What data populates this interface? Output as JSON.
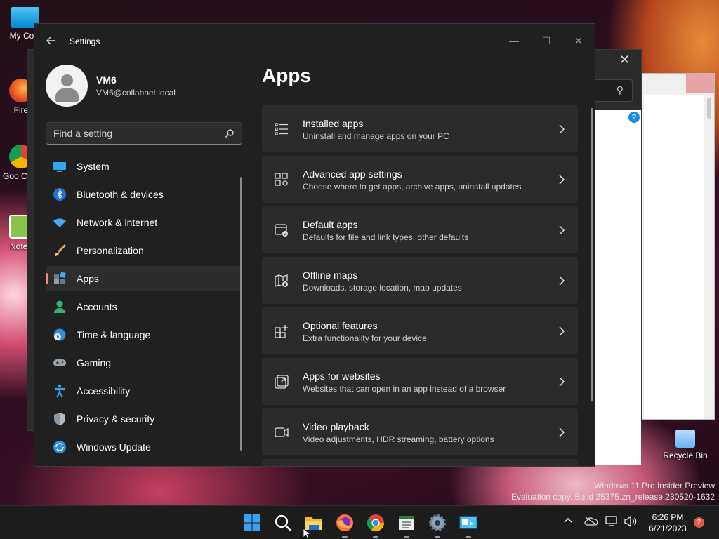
{
  "desktop": {
    "icons": [
      {
        "label": "My Com",
        "icon": "computer-icon"
      },
      {
        "label": "Fire",
        "icon": "firefox-icon"
      },
      {
        "label": "Goo Chro",
        "icon": "chrome-icon"
      },
      {
        "label": "Notep",
        "icon": "notepad-icon"
      }
    ],
    "recycle_bin": "Recycle Bin",
    "watermark": {
      "line1": "Windows 11 Pro Insider Preview",
      "line2": "Evaluation copy. Build 25375.zn_release.230520-1632"
    }
  },
  "settings": {
    "window_title": "Settings",
    "controls": {
      "minimize": "—",
      "maximize": "☐",
      "close": "✕"
    },
    "user": {
      "name": "VM6",
      "email": "VM6@collabnet.local"
    },
    "search": {
      "placeholder": "Find a setting"
    },
    "nav": [
      {
        "label": "System",
        "icon": "system-icon"
      },
      {
        "label": "Bluetooth & devices",
        "icon": "bluetooth-icon"
      },
      {
        "label": "Network & internet",
        "icon": "wifi-icon"
      },
      {
        "label": "Personalization",
        "icon": "brush-icon"
      },
      {
        "label": "Apps",
        "icon": "apps-icon",
        "selected": true
      },
      {
        "label": "Accounts",
        "icon": "person-icon"
      },
      {
        "label": "Time & language",
        "icon": "globe-clock-icon"
      },
      {
        "label": "Gaming",
        "icon": "gamepad-icon"
      },
      {
        "label": "Accessibility",
        "icon": "accessibility-icon"
      },
      {
        "label": "Privacy & security",
        "icon": "shield-icon"
      },
      {
        "label": "Windows Update",
        "icon": "update-icon"
      }
    ],
    "page_title": "Apps",
    "cards": [
      {
        "title": "Installed apps",
        "subtitle": "Uninstall and manage apps on your PC",
        "icon": "list-icon"
      },
      {
        "title": "Advanced app settings",
        "subtitle": "Choose where to get apps, archive apps, uninstall updates",
        "icon": "app-gear-icon"
      },
      {
        "title": "Default apps",
        "subtitle": "Defaults for file and link types, other defaults",
        "icon": "default-apps-icon"
      },
      {
        "title": "Offline maps",
        "subtitle": "Downloads, storage location, map updates",
        "icon": "map-icon"
      },
      {
        "title": "Optional features",
        "subtitle": "Extra functionality for your device",
        "icon": "add-grid-icon"
      },
      {
        "title": "Apps for websites",
        "subtitle": "Websites that can open in an app instead of a browser",
        "icon": "open-link-icon"
      },
      {
        "title": "Video playback",
        "subtitle": "Video adjustments, HDR streaming, battery options",
        "icon": "video-icon"
      }
    ]
  },
  "taskbar": {
    "apps": [
      "start-icon",
      "search-icon",
      "file-explorer-icon",
      "firefox-icon",
      "chrome-icon",
      "notepad-icon",
      "settings-gear-icon",
      "control-panel-icon"
    ],
    "clock_time": "6:26 PM",
    "clock_date": "6/21/2023",
    "notification_count": "2"
  },
  "colors": {
    "accent": "#f08a7a",
    "window_bg": "#202020",
    "card_bg": "#2b2b2b"
  }
}
